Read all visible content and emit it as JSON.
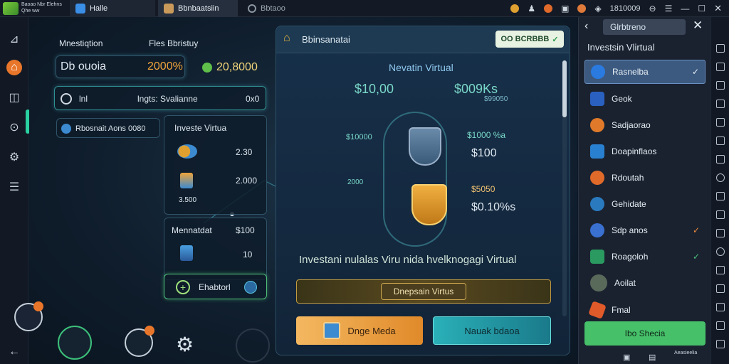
{
  "topbar": {
    "app_title": "Baoao Nbr Elehns Qhe ww",
    "tab_home": "Halle",
    "tab_game": "Bbnbaatsiin",
    "tab_ext": "Bbtaoo",
    "counter": "1810009"
  },
  "leftpanel": {
    "header_left": "Mnestiqtion",
    "header_right": "Fles Bbristuy",
    "balance_label": "Db ouoia",
    "balance_pct": "2000%",
    "balance_value": "20,8000",
    "row2_left": "lnl",
    "row2_mid": "lngts: Svalianne",
    "row2_right": "0x0",
    "row3_label": "Rbosnait Aons 0080",
    "invest_title": "Investe Virtua",
    "invest_val1": "2.30",
    "invest_val2": "2.000",
    "invest_val3": "3.500",
    "mon_title": "Mennatdat",
    "mon_val1": "$100",
    "mon_val2": "10",
    "add_button": "Ehabtorl"
  },
  "card": {
    "header_title": "Bbinsanatai",
    "header_button": "OO BCRBBB",
    "subtitle": "Nevatin Virtual",
    "val_left": "$10,00",
    "val_right": "$009Ks",
    "val_right_sub": "$99050",
    "node_left": "$10000",
    "node_left2": "2000",
    "node_r1": "$1000 %a",
    "node_r2": "$100",
    "node_r3": "$5050",
    "node_r4": "$0.10%s",
    "caption": "Investani nulalas Viru nida hvelknogagi Virtual",
    "deposit_button": "Dnepsain Virtus",
    "btn_left": "Dnge Meda",
    "btn_right": "Nauak bdaoa"
  },
  "drawer": {
    "search_text": "Glrbtreno",
    "title": "Investsin Vlirtual",
    "items": [
      {
        "label": "Rasnelba"
      },
      {
        "label": "Geok"
      },
      {
        "label": "Sadjaorao"
      },
      {
        "label": "Doapinflaos"
      },
      {
        "label": "Rdoutah"
      },
      {
        "label": "Gehidate"
      },
      {
        "label": "Sdp anos"
      },
      {
        "label": "Roagoloh"
      },
      {
        "label": "Aoilat"
      },
      {
        "label": "Fmal"
      }
    ],
    "cta": "Ibo Shecia",
    "footer": "Aeasieelia"
  },
  "colors": {
    "accent_green": "#47c06a",
    "accent_orange": "#f0a43a",
    "accent_teal": "#2fb5c8"
  }
}
